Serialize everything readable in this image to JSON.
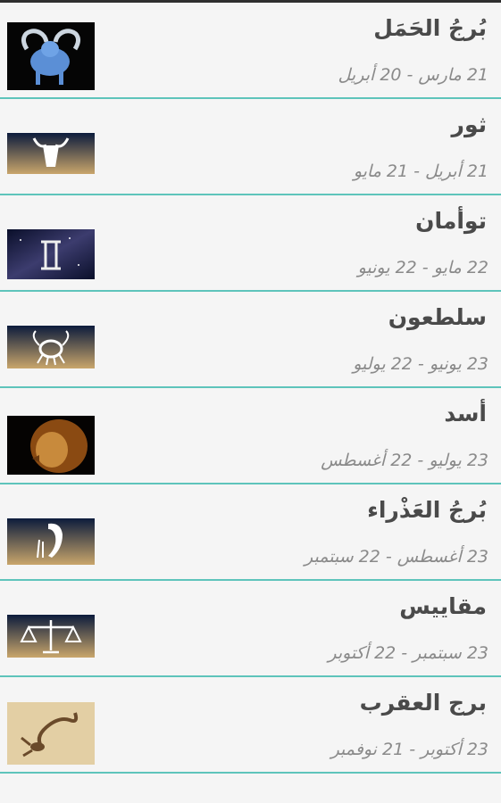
{
  "signs": [
    {
      "name": "بُرجُ الحَمَل",
      "dates": "21 مارس - 20 أبريل",
      "icon": "aries-icon"
    },
    {
      "name": "ثور",
      "dates": "21 أبريل - 21 مايو",
      "icon": "taurus-icon"
    },
    {
      "name": "توأمان",
      "dates": "22 مايو - 22 يونيو",
      "icon": "gemini-icon"
    },
    {
      "name": "سلطعون",
      "dates": "23 يونيو - 22 يوليو",
      "icon": "cancer-icon"
    },
    {
      "name": "أسد",
      "dates": "23 يوليو - 22 أغسطس",
      "icon": "leo-icon"
    },
    {
      "name": "بُرجُ العَذْراء",
      "dates": "23 أغسطس - 22 سبتمبر",
      "icon": "virgo-icon"
    },
    {
      "name": "مقاييس",
      "dates": "23 سبتمبر - 22 أكتوبر",
      "icon": "libra-icon"
    },
    {
      "name": "برج العقرب",
      "dates": "23 أكتوبر - 21 نوفمبر",
      "icon": "scorpio-icon"
    }
  ],
  "colors": {
    "divider": "#5ec4bb",
    "title": "#4a4a4a",
    "subtitle": "#8a8a8a"
  }
}
